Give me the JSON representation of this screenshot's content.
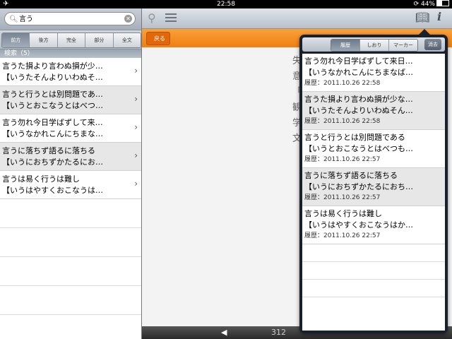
{
  "status": {
    "time": "22:58",
    "battery": "44%",
    "airplane_icon": "airplane-icon"
  },
  "search": {
    "query": "言う",
    "scopes": [
      "前方",
      "後方",
      "完全",
      "部分",
      "全文"
    ],
    "active_scope": 0
  },
  "results": {
    "header": "検索（5）",
    "items": [
      {
        "title": "言うた損より言わぬ損が少…",
        "reading": "【いうたそんよりいわぬそ…"
      },
      {
        "title": "言うと行うとは別問題であ…",
        "reading": "【いうとおこなうとはべつ…"
      },
      {
        "title": "言う勿れ今日学ばずして来…",
        "reading": "【いうなかれこんにちまな…"
      },
      {
        "title": "言うに落ちず語るに落ちる",
        "reading": "【いうにおちずかたるにお…"
      },
      {
        "title": "言うは易く行うは難し",
        "reading": "【いうはやすくおこなうは…"
      }
    ]
  },
  "toolbar": {
    "back_label": "戻る"
  },
  "content": {
    "glyphs": [
      "失",
      "意",
      "「",
      "観",
      "学",
      "文"
    ]
  },
  "bottom": {
    "page": "312"
  },
  "popover": {
    "tabs": [
      "履歴",
      "しおり",
      "マーカー"
    ],
    "active_tab": 0,
    "delete_label": "消去",
    "items": [
      {
        "title": "言う勿れ今日学ばずして来日…",
        "reading": "【いうなかれこんにちまなば…",
        "date": "履歴：2011.10.26 22:58"
      },
      {
        "title": "言うた損より言わぬ損が少な…",
        "reading": "【いうたそんよりいわぬそん…",
        "date": "履歴：2011.10.26 22:58"
      },
      {
        "title": "言うと行うとは別問題である",
        "reading": "【いうとおこなうとはべつも…",
        "date": "履歴：2011.10.26 22:57"
      },
      {
        "title": "言うに落ちず語るに落ちる",
        "reading": "【いうにおちずかたるにおち…",
        "date": "履歴：2011.10.26 22:57"
      },
      {
        "title": "言うは易く行うは難し",
        "reading": "【いうはやすくおこなうはか…",
        "date": "履歴：2011.10.26 22:57"
      }
    ]
  }
}
